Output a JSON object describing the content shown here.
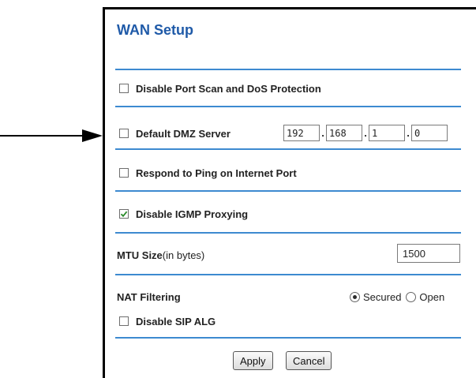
{
  "panel": {
    "title": "WAN Setup"
  },
  "options": {
    "disable_port_scan": {
      "label": "Disable Port Scan and DoS Protection",
      "checked": false
    },
    "default_dmz": {
      "label": "Default DMZ Server",
      "checked": false,
      "ip": [
        "192",
        "168",
        "1",
        "0"
      ],
      "separator": "."
    },
    "respond_ping": {
      "label": "Respond to Ping on Internet Port",
      "checked": false
    },
    "disable_igmp": {
      "label": "Disable IGMP Proxying",
      "checked": true
    },
    "mtu": {
      "label_bold": "MTU Size",
      "label_suffix": "(in bytes)",
      "value": "1500"
    },
    "nat_filtering": {
      "label": "NAT Filtering",
      "options": [
        "Secured",
        "Open"
      ],
      "selected": "Secured"
    },
    "disable_sip_alg": {
      "label": "Disable SIP ALG",
      "checked": false
    }
  },
  "buttons": {
    "apply": "Apply",
    "cancel": "Cancel"
  },
  "colors": {
    "title": "#1f5aa8",
    "rule": "#3d8ad0",
    "checkmark": "#2a8a2a"
  }
}
